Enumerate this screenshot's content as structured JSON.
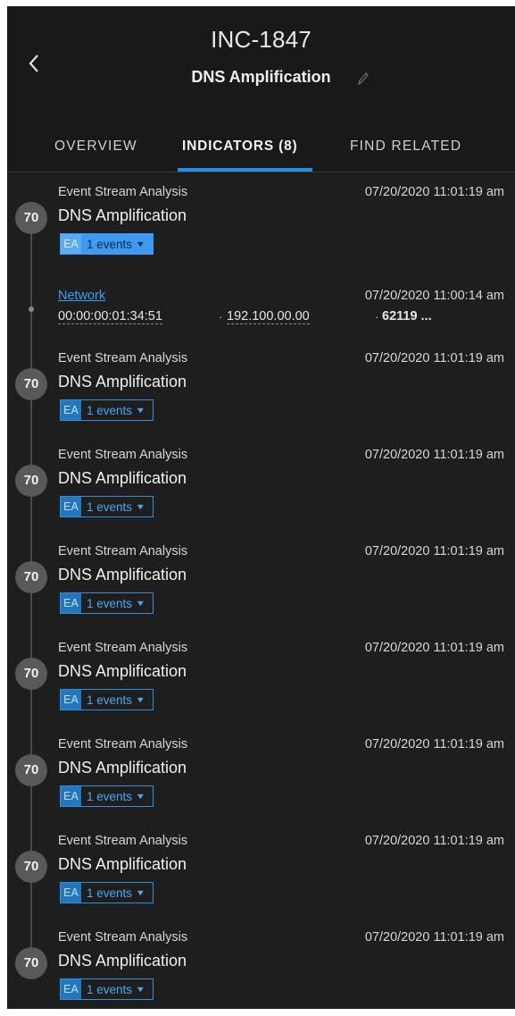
{
  "header": {
    "incident_id": "INC-1847",
    "title": "DNS Amplification",
    "back_icon": "chevron-left-icon",
    "edit_icon": "pencil-icon"
  },
  "tabs": [
    {
      "label": "OVERVIEW",
      "active": false
    },
    {
      "label": "INDICATORS (8)",
      "active": true
    },
    {
      "label": "FIND RELATED",
      "active": false
    }
  ],
  "colors": {
    "accent": "#1f92e8",
    "background": "#1e1e1e"
  },
  "indicators": [
    {
      "score": "70",
      "source": "Event Stream Analysis",
      "timestamp": "07/20/2020 11:01:19 am",
      "name": "DNS Amplification",
      "tag": "EA",
      "events": "1 events",
      "expanded": true
    },
    {
      "score": "70",
      "source": "Event Stream Analysis",
      "timestamp": "07/20/2020 11:01:19 am",
      "name": "DNS Amplification",
      "tag": "EA",
      "events": "1 events",
      "expanded": false
    },
    {
      "score": "70",
      "source": "Event Stream Analysis",
      "timestamp": "07/20/2020 11:01:19 am",
      "name": "DNS Amplification",
      "tag": "EA",
      "events": "1 events",
      "expanded": false
    },
    {
      "score": "70",
      "source": "Event Stream Analysis",
      "timestamp": "07/20/2020 11:01:19 am",
      "name": "DNS Amplification",
      "tag": "EA",
      "events": "1 events",
      "expanded": false
    },
    {
      "score": "70",
      "source": "Event Stream Analysis",
      "timestamp": "07/20/2020 11:01:19 am",
      "name": "DNS Amplification",
      "tag": "EA",
      "events": "1 events",
      "expanded": false
    },
    {
      "score": "70",
      "source": "Event Stream Analysis",
      "timestamp": "07/20/2020 11:01:19 am",
      "name": "DNS Amplification",
      "tag": "EA",
      "events": "1 events",
      "expanded": false
    },
    {
      "score": "70",
      "source": "Event Stream Analysis",
      "timestamp": "07/20/2020 11:01:19 am",
      "name": "DNS Amplification",
      "tag": "EA",
      "events": "1 events",
      "expanded": false
    },
    {
      "score": "70",
      "source": "Event Stream Analysis",
      "timestamp": "07/20/2020 11:01:19 am",
      "name": "DNS Amplification",
      "tag": "EA",
      "events": "1 events",
      "expanded": false
    }
  ],
  "network_event": {
    "link_label": "Network",
    "timestamp": "07/20/2020 11:00:14 am",
    "mac": "00:00:00:01:34:51",
    "ip": "192.100.00.00",
    "port": "62119 ..."
  }
}
